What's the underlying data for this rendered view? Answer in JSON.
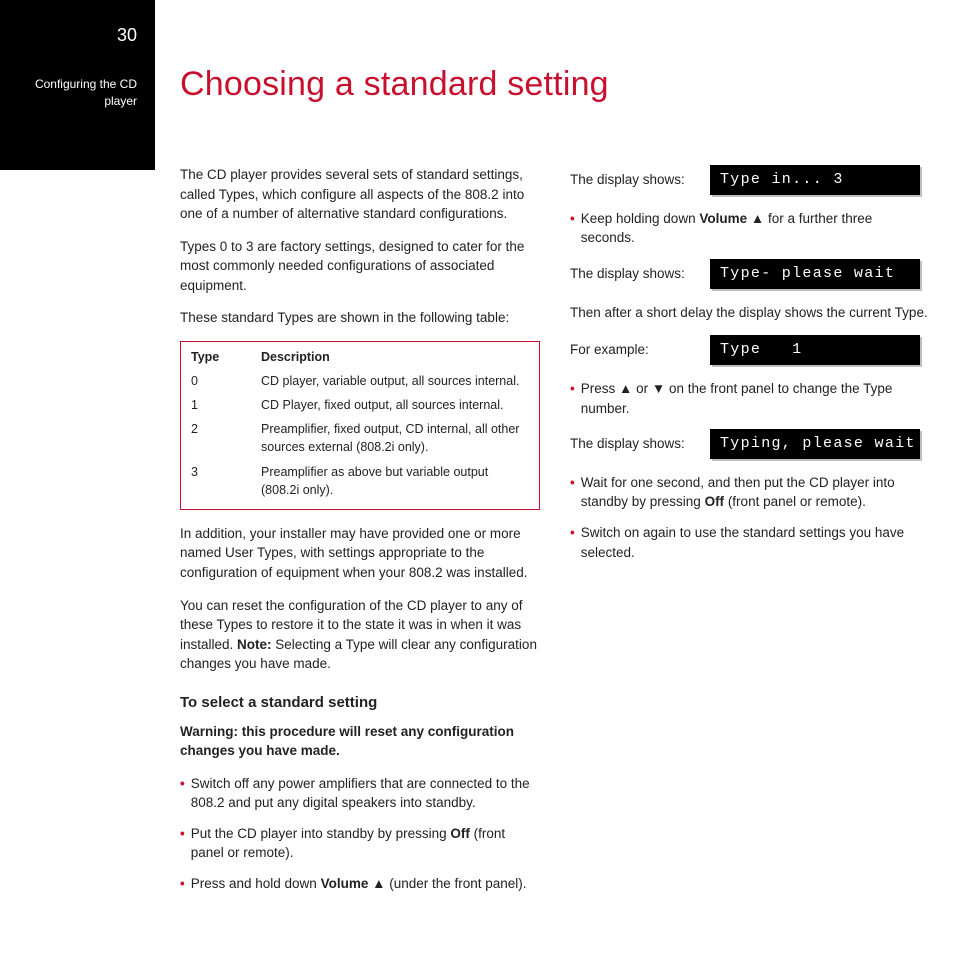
{
  "page_number": "30",
  "section_label_1": "Configuring the CD",
  "section_label_2": "player",
  "title": "Choosing a standard setting",
  "col1": {
    "p1": "The CD player provides several sets of standard settings, called Types, which configure all aspects of the 808.2 into one of a number of alternative standard configurations.",
    "p2": "Types 0 to 3 are factory settings, designed to cater for the most commonly needed configurations of associated equipment.",
    "p3": "These standard Types are shown in the following table:",
    "table": {
      "h1": "Type",
      "h2": "Description",
      "rows": [
        {
          "t": "0",
          "d": "CD player, variable output, all sources internal."
        },
        {
          "t": "1",
          "d": "CD Player, fixed output, all sources internal."
        },
        {
          "t": "2",
          "d": "Preamplifier, fixed output, CD internal, all other sources external (808.2i only)."
        },
        {
          "t": "3",
          "d": "Preamplifier as above but variable output (808.2i only)."
        }
      ]
    },
    "p4": "In addition, your installer may have provided one or more named User Types, with settings appropriate to the configuration of equipment when your 808.2 was installed.",
    "p5a": "You can reset the configuration of the CD player to any of these Types to restore it to the state it was in when it was installed. ",
    "p5b": "Note:",
    "p5c": " Selecting a Type will clear any configuration changes you have made.",
    "subhead": "To select a standard setting",
    "warning": "Warning: this procedure will reset any configuration changes you have made.",
    "b1": "Switch off any power amplifiers that are connected to the 808.2 and put any digital speakers into standby.",
    "b2a": "Put the CD player into standby by pressing ",
    "b2b": "Off",
    "b2c": " (front panel or remote).",
    "b3a": "Press and hold down ",
    "b3b": "Volume",
    "b3c": " ▲ (under the front panel)."
  },
  "col2": {
    "dl1": "The display shows:",
    "lcd1": "Type in... 3",
    "b1a": "Keep holding down ",
    "b1b": "Volume",
    "b1c": " ▲ for a further three seconds.",
    "dl2": "The display shows:",
    "lcd2": "Type- please wait",
    "p1": "Then after a short delay the display shows the current Type.",
    "dl3": "For example:",
    "lcd3": "Type   1",
    "b2": "Press ▲ or ▼ on the front panel to change the Type number.",
    "dl4": "The display shows:",
    "lcd4": "Typing, please wait",
    "b3a": "Wait for one second, and then put the CD player into standby by pressing ",
    "b3b": "Off",
    "b3c": " (front panel or remote).",
    "b4": "Switch on again to use the standard settings you have selected."
  }
}
